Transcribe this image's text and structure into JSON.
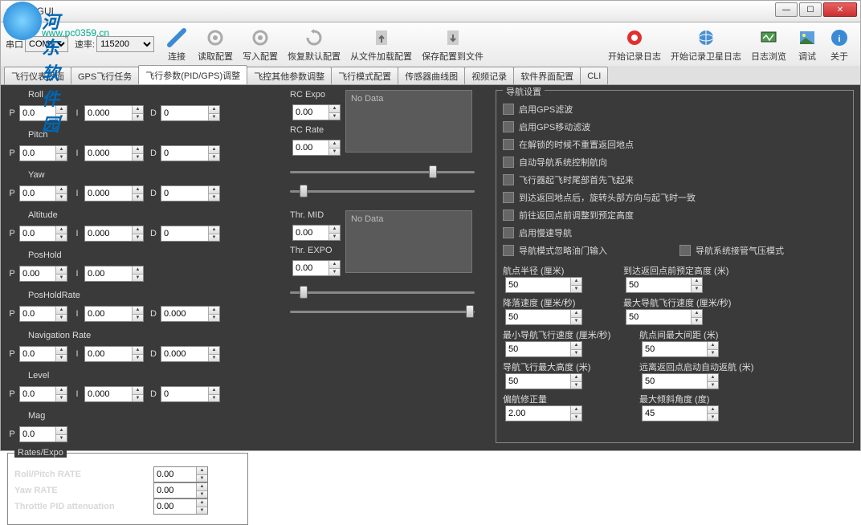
{
  "window": {
    "title": "WinGUI"
  },
  "watermark": {
    "text": "河东软件园",
    "url": "www.pc0359.cn"
  },
  "port": {
    "label": "串口",
    "value": "COM1",
    "baud_label": "速率:",
    "baud": "115200"
  },
  "toolbar": {
    "connect": "连接",
    "read": "读取配置",
    "write": "写入配置",
    "restore": "恢复默认配置",
    "loadfile": "从文件加载配置",
    "savefile": "保存配置到文件",
    "startlog": "开始记录日志",
    "startgps": "开始记录卫星日志",
    "logview": "日志浏览",
    "debug": "调试",
    "about": "关于"
  },
  "tabs": [
    "飞行仪表界面",
    "GPS飞行任务",
    "飞行参数(PID/GPS)调整",
    "飞控其他参数调整",
    "飞行模式配置",
    "传感器曲线图",
    "视频记录",
    "软件界面配置",
    "CLI"
  ],
  "pid": {
    "roll": {
      "name": "Roll",
      "p": "0.0",
      "i": "0.000",
      "d": "0"
    },
    "pitch": {
      "name": "Pitch",
      "p": "0.0",
      "i": "0.000",
      "d": "0"
    },
    "yaw": {
      "name": "Yaw",
      "p": "0.0",
      "i": "0.000",
      "d": "0"
    },
    "alt": {
      "name": "Altitude",
      "p": "0.0",
      "i": "0.000",
      "d": "0"
    },
    "poshold": {
      "name": "PosHold",
      "p": "0.00",
      "i": "0.00"
    },
    "posholdrate": {
      "name": "PosHoldRate",
      "p": "0.0",
      "i": "0.00",
      "d": "0.000"
    },
    "navrate": {
      "name": "Navigation Rate",
      "p": "0.0",
      "i": "0.00",
      "d": "0.000"
    },
    "level": {
      "name": "Level",
      "p": "0.0",
      "i": "0.000",
      "d": "0"
    },
    "mag": {
      "name": "Mag",
      "p": "0.0"
    }
  },
  "rates": {
    "legend": "Rates/Expo",
    "rollpitch_label": "Roll/Pitch RATE",
    "rollpitch": "0.00",
    "yaw_label": "Yaw RATE",
    "yaw": "0.00",
    "tpa_label": "Throttle PID attenuation",
    "tpa": "0.00"
  },
  "rc": {
    "expo_label": "RC Expo",
    "expo": "0.00",
    "rate_label": "RC Rate",
    "rate": "0.00",
    "thrmid_label": "Thr. MID",
    "thrmid": "0.00",
    "threxpo_label": "Thr. EXPO",
    "threxpo": "0.00",
    "nodata": "No Data"
  },
  "nav": {
    "legend": "导航设置",
    "opts": [
      "启用GPS滤波",
      "启用GPS移动滤波",
      "在解锁的时候不重置返回地点",
      "自动导航系统控制航向",
      "飞行器起飞时尾部首先飞起来",
      "到达返回地点后，旋转头部方向与起飞时一致",
      "前往返回点前调整到预定高度",
      "启用慢速导航"
    ],
    "opt9a": "导航模式忽略油门输入",
    "opt9b": "导航系统接管气压模式",
    "p1": {
      "lbl": "航点半径 (厘米)",
      "v": "50"
    },
    "p2": {
      "lbl": "到达返回点前预定高度 (米)",
      "v": "50"
    },
    "p3": {
      "lbl": "降落速度 (厘米/秒)",
      "v": "50"
    },
    "p4": {
      "lbl": "最大导航飞行速度 (厘米/秒)",
      "v": "50"
    },
    "p5": {
      "lbl": "最小导航飞行速度 (厘米/秒)",
      "v": "50"
    },
    "p6": {
      "lbl": "航点间最大间距 (米)",
      "v": "50"
    },
    "p7": {
      "lbl": "导航飞行最大高度 (米)",
      "v": "50"
    },
    "p8": {
      "lbl": "远离返回点启动自动返航 (米)",
      "v": "50"
    },
    "p9": {
      "lbl": "偏航修正量",
      "v": "2.00"
    },
    "p10": {
      "lbl": "最大倾斜角度 (度)",
      "v": "45"
    }
  }
}
